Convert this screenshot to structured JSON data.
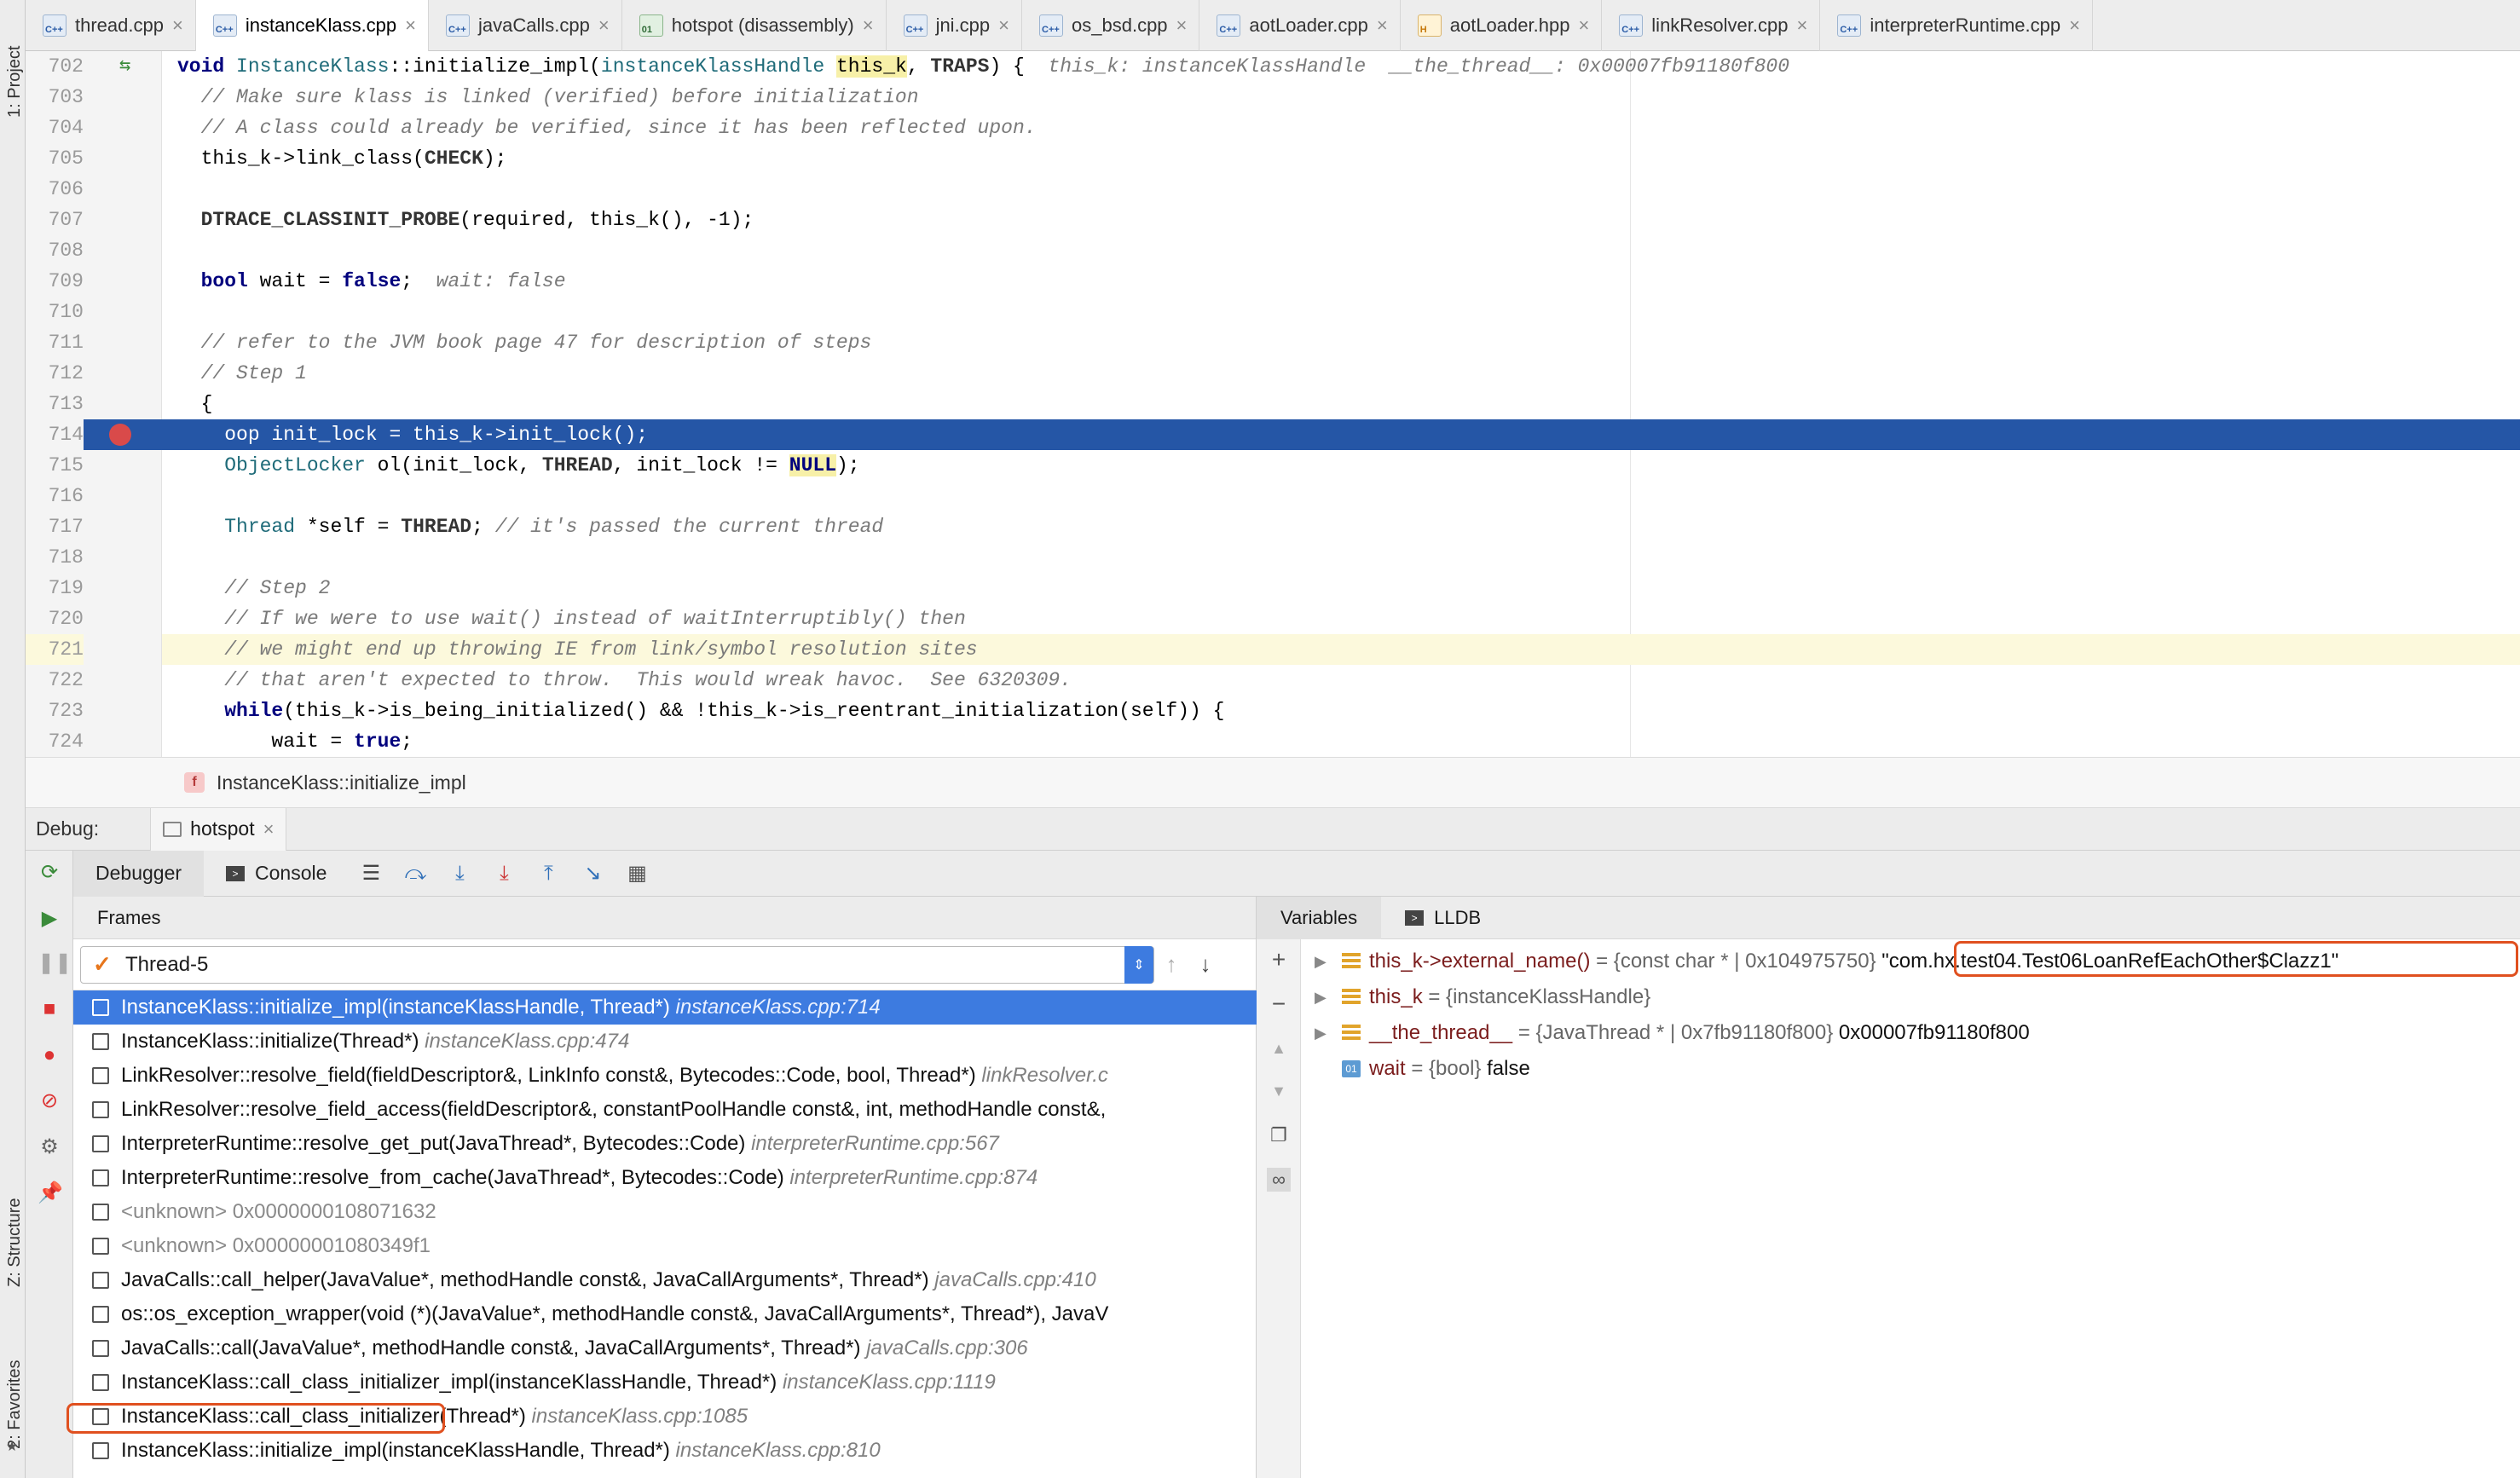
{
  "side_strip": {
    "project_label": "1: Project",
    "structure_label": "Z: Structure",
    "favorites_label": "2: Favorites"
  },
  "tabs": [
    {
      "label": "thread.cpp",
      "icon": "cpp-file-icon",
      "active": false
    },
    {
      "label": "instanceKlass.cpp",
      "icon": "cpp-file-icon",
      "active": true
    },
    {
      "label": "javaCalls.cpp",
      "icon": "cpp-file-icon",
      "active": false
    },
    {
      "label": "hotspot (disassembly)",
      "icon": "asm-file-icon",
      "active": false
    },
    {
      "label": "jni.cpp",
      "icon": "cpp-file-icon",
      "active": false
    },
    {
      "label": "os_bsd.cpp",
      "icon": "cpp-file-icon",
      "active": false
    },
    {
      "label": "aotLoader.cpp",
      "icon": "cpp-file-icon",
      "active": false
    },
    {
      "label": "aotLoader.hpp",
      "icon": "hpp-file-icon",
      "active": false
    },
    {
      "label": "linkResolver.cpp",
      "icon": "cpp-file-icon",
      "active": false
    },
    {
      "label": "interpreterRuntime.cpp",
      "icon": "cpp-file-icon",
      "active": false
    }
  ],
  "editor": {
    "lines": [
      {
        "n": "702",
        "text": "void InstanceKlass::initialize_impl(instanceKlassHandle this_k, TRAPS) {  this_k: instanceKlassHandle  __the_thread__: 0x00007fb91180f800"
      },
      {
        "n": "703",
        "text": "  // Make sure klass is linked (verified) before initialization"
      },
      {
        "n": "704",
        "text": "  // A class could already be verified, since it has been reflected upon."
      },
      {
        "n": "705",
        "text": "  this_k->link_class(CHECK);"
      },
      {
        "n": "706",
        "text": ""
      },
      {
        "n": "707",
        "text": "  DTRACE_CLASSINIT_PROBE(required, this_k(), -1);"
      },
      {
        "n": "708",
        "text": ""
      },
      {
        "n": "709",
        "text": "  bool wait = false;  wait: false"
      },
      {
        "n": "710",
        "text": ""
      },
      {
        "n": "711",
        "text": "  // refer to the JVM book page 47 for description of steps"
      },
      {
        "n": "712",
        "text": "  // Step 1"
      },
      {
        "n": "713",
        "text": "  {"
      },
      {
        "n": "714",
        "text": "    oop init_lock = this_k->init_lock();"
      },
      {
        "n": "715",
        "text": "    ObjectLocker ol(init_lock, THREAD, init_lock != NULL);"
      },
      {
        "n": "716",
        "text": ""
      },
      {
        "n": "717",
        "text": "    Thread *self = THREAD; // it's passed the current thread"
      },
      {
        "n": "718",
        "text": ""
      },
      {
        "n": "719",
        "text": "    // Step 2"
      },
      {
        "n": "720",
        "text": "    // If we were to use wait() instead of waitInterruptibly() then"
      },
      {
        "n": "721",
        "text": "    // we might end up throwing IE from link/symbol resolution sites"
      },
      {
        "n": "722",
        "text": "    // that aren't expected to throw.  This would wreak havoc.  See 6320309."
      },
      {
        "n": "723",
        "text": "    while(this_k->is_being_initialized() && !this_k->is_reentrant_initialization(self)) {"
      },
      {
        "n": "724",
        "text": "        wait = true;"
      }
    ],
    "selected_line": "714",
    "current_line": "721"
  },
  "breadcrumb": {
    "badge": "f",
    "label": "InstanceKlass::initialize_impl"
  },
  "debug": {
    "title": "Debug:",
    "session_tab": "hotspot",
    "debugger_tab": "Debugger",
    "console_tab": "Console",
    "frames_header": "Frames",
    "thread": "Thread-5",
    "frames": [
      {
        "func": "InstanceKlass::initialize_impl(instanceKlassHandle, Thread*)",
        "file": "instanceKlass.cpp:714"
      },
      {
        "func": "InstanceKlass::initialize(Thread*)",
        "file": "instanceKlass.cpp:474"
      },
      {
        "func": "LinkResolver::resolve_field(fieldDescriptor&, LinkInfo const&, Bytecodes::Code, bool, Thread*)",
        "file": "linkResolver.c"
      },
      {
        "func": "LinkResolver::resolve_field_access(fieldDescriptor&, constantPoolHandle const&, int, methodHandle const&,",
        "file": ""
      },
      {
        "func": "InterpreterRuntime::resolve_get_put(JavaThread*, Bytecodes::Code)",
        "file": "interpreterRuntime.cpp:567"
      },
      {
        "func": "InterpreterRuntime::resolve_from_cache(JavaThread*, Bytecodes::Code)",
        "file": "interpreterRuntime.cpp:874"
      },
      {
        "func": "<unknown> 0x0000000108071632",
        "file": ""
      },
      {
        "func": "<unknown> 0x00000001080349f1",
        "file": ""
      },
      {
        "func": "JavaCalls::call_helper(JavaValue*, methodHandle const&, JavaCallArguments*, Thread*)",
        "file": "javaCalls.cpp:410"
      },
      {
        "func": "os::os_exception_wrapper(void (*)(JavaValue*, methodHandle const&, JavaCallArguments*, Thread*), JavaV",
        "file": ""
      },
      {
        "func": "JavaCalls::call(JavaValue*, methodHandle const&, JavaCallArguments*, Thread*)",
        "file": "javaCalls.cpp:306"
      },
      {
        "func": "InstanceKlass::call_class_initializer_impl(instanceKlassHandle, Thread*)",
        "file": "instanceKlass.cpp:1119"
      },
      {
        "func": "InstanceKlass::call_class_initializer(Thread*)",
        "file": "instanceKlass.cpp:1085"
      },
      {
        "func": "InstanceKlass::initialize_impl(instanceKlassHandle, Thread*)",
        "file": "instanceKlass.cpp:810"
      }
    ],
    "variables_tab": "Variables",
    "lldb_tab": "LLDB",
    "variables": [
      {
        "name": "this_k->external_name()",
        "type": " = {const char * | 0x104975750} ",
        "value": "\"com.hx.test04.Test06LoanRefEachOther$Clazz1\"",
        "icon": "field",
        "expandable": true
      },
      {
        "name": "this_k",
        "type": " = {instanceKlassHandle}",
        "value": "",
        "icon": "field",
        "expandable": true
      },
      {
        "name": "__the_thread__",
        "type": " = {JavaThread * | 0x7fb91180f800} ",
        "value": "0x00007fb91180f800",
        "icon": "field",
        "expandable": true
      },
      {
        "name": "wait",
        "type": " = {bool} ",
        "value": "false",
        "icon": "bool",
        "expandable": false
      }
    ]
  },
  "colors": {
    "selection": "#2556a6",
    "frame_selection": "#3d7be0",
    "highlight_box": "#e0501f"
  }
}
